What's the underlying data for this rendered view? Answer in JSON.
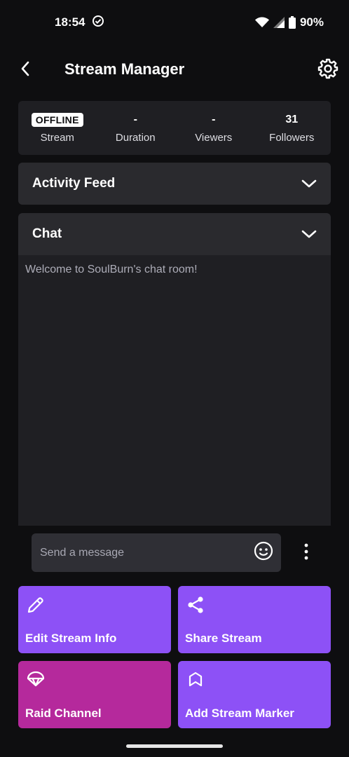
{
  "status_bar": {
    "time": "18:54",
    "battery": "90%",
    "icons": [
      "check-circle-icon",
      "wifi-icon",
      "signal-icon",
      "battery-icon"
    ]
  },
  "header": {
    "title": "Stream Manager",
    "back_icon": "chevron-left-icon",
    "settings_icon": "gear-icon"
  },
  "stats": [
    {
      "value": "OFFLINE",
      "label": "Stream",
      "badge": true
    },
    {
      "value": "-",
      "label": "Duration"
    },
    {
      "value": "-",
      "label": "Viewers"
    },
    {
      "value": "31",
      "label": "Followers"
    }
  ],
  "panels": {
    "activity_feed": {
      "title": "Activity Feed",
      "icon": "chevron-down-icon"
    },
    "chat": {
      "title": "Chat",
      "icon": "chevron-down-icon"
    }
  },
  "chat": {
    "welcome_message": "Welcome to SoulBurn's chat room!",
    "input_placeholder": "Send a message",
    "input_value": "",
    "emoji_icon": "smiley-icon",
    "more_icon": "vertical-dots-icon"
  },
  "actions": [
    {
      "label": "Edit Stream Info",
      "icon": "pencil-icon",
      "color": "#8d51f6"
    },
    {
      "label": "Share Stream",
      "icon": "share-icon",
      "color": "#8d51f6"
    },
    {
      "label": "Raid Channel",
      "icon": "parachute-icon",
      "color": "#b5299c"
    },
    {
      "label": "Add Stream Marker",
      "icon": "bookmark-icon",
      "color": "#8d51f6"
    }
  ],
  "colors": {
    "background": "#0e0e10",
    "card": "#1f1f23",
    "panel_header": "#2a2a2e",
    "accent_purple": "#8d51f6",
    "raid_magenta": "#b5299c"
  }
}
